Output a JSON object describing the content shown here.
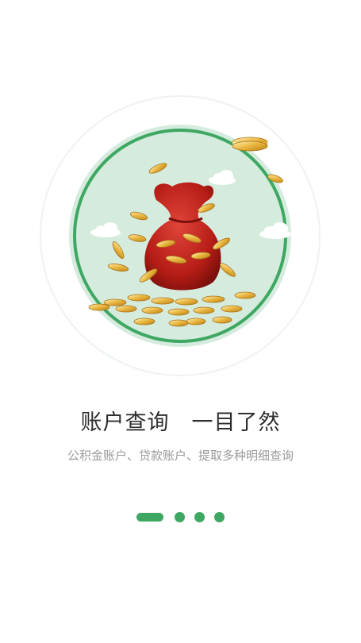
{
  "onboarding": {
    "title": "账户查询　一目了然",
    "subtitle": "公积金账户、贷款账户、提取多种明细查询",
    "page_count": 4,
    "current_page": 1
  },
  "colors": {
    "accent": "#3ea862",
    "ring_outer": "#e8f2ec",
    "circle_fill": "#d5ebdd",
    "bag": "#c62a20",
    "coin": "#e8b84a"
  },
  "illustration": {
    "icons": [
      "money-bag-icon",
      "gold-coins-icon",
      "cloud-icon"
    ]
  }
}
